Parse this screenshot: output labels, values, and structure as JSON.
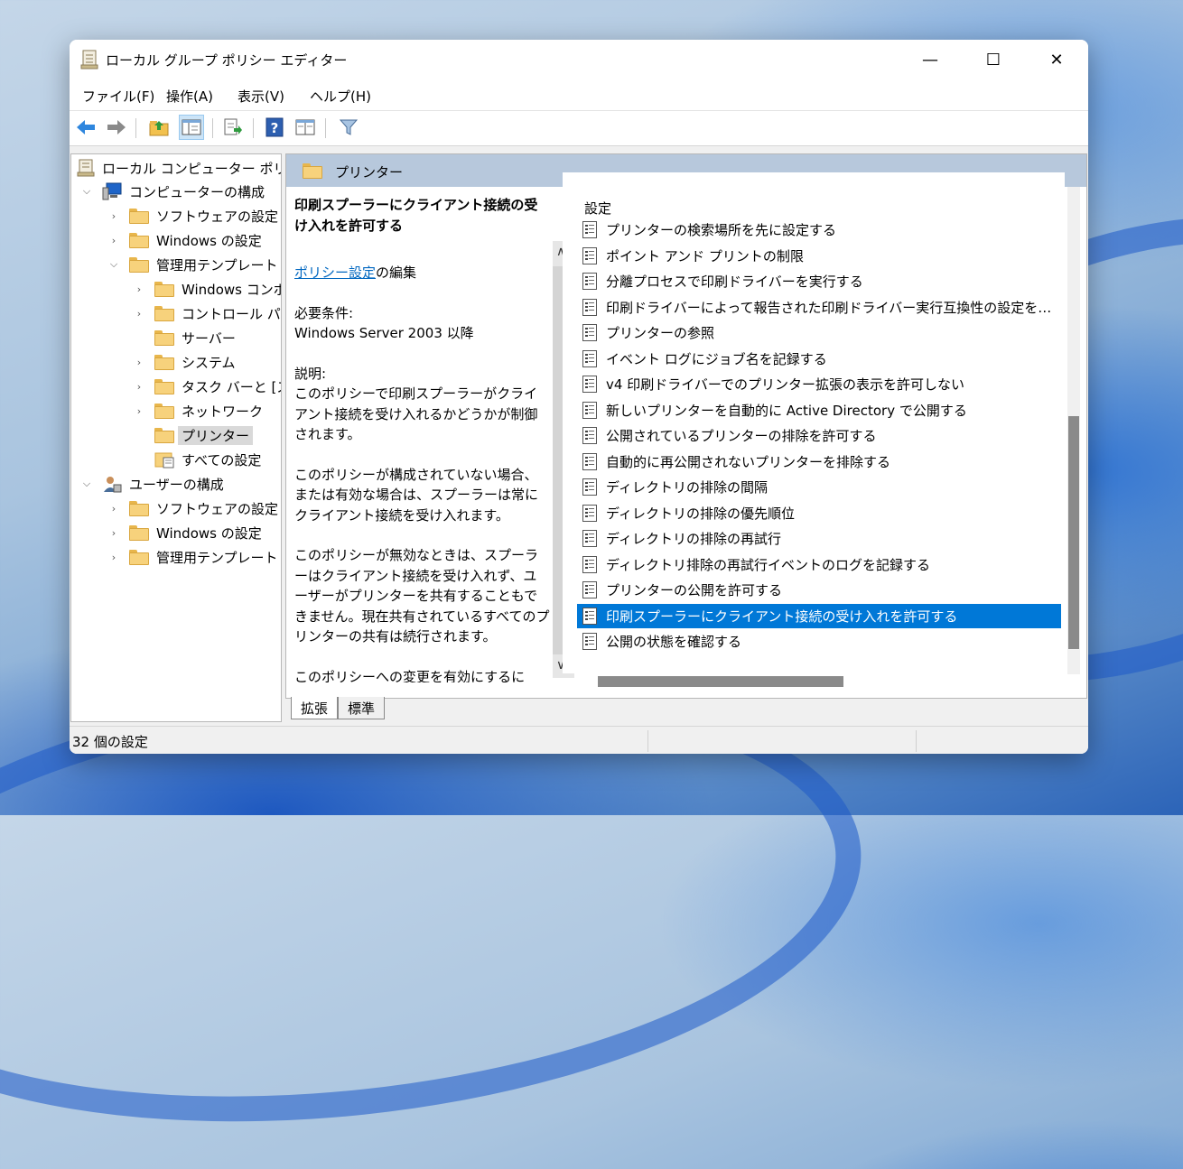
{
  "window": {
    "title": "ローカル グループ ポリシー エディター",
    "minimize": "—",
    "maximize": "☐",
    "close": "✕"
  },
  "menu": [
    "ファイル(F)",
    "操作(A)",
    "表示(V)",
    "ヘルプ(H)"
  ],
  "toolbar_icons": [
    "back-arrow-icon",
    "forward-arrow-icon",
    "up-folder-icon",
    "show-hide-tree-icon",
    "export-list-icon",
    "help-icon",
    "properties-icon",
    "filter-icon"
  ],
  "tree": {
    "root": "ローカル コンピューター ポリシー",
    "computer": "コンピューターの構成",
    "software": "ソフトウェアの設定",
    "windows": "Windows の設定",
    "admin": "管理用テンプレート",
    "win_components": "Windows コンポーネント",
    "control_panel": "コントロール パネル",
    "server": "サーバー",
    "system": "システム",
    "taskbar": "タスク バーと [スタート] メニュー",
    "network": "ネットワーク",
    "printers": "プリンター",
    "all_settings": "すべての設定",
    "user": "ユーザーの構成",
    "u_software": "ソフトウェアの設定",
    "u_windows": "Windows の設定",
    "u_admin": "管理用テンプレート"
  },
  "pane_title": "プリンター",
  "description": {
    "heading": "印刷スプーラーにクライアント接続の受け入れを許可する",
    "link": "ポリシー設定",
    "link_suffix": "の編集",
    "req_label": "必要条件:",
    "req_value": "Windows Server 2003 以降",
    "desc_label": "説明:",
    "p1": "このポリシーで印刷スプーラーがクライアント接続を受け入れるかどうかが制御されます。",
    "p2": "このポリシーが構成されていない場合、または有効な場合は、スプーラーは常にクライアント接続を受け入れます。",
    "p3": "このポリシーが無効なときは、スプーラーはクライアント接続を受け入れず、ユーザーがプリンターを共有することもできません。現在共有されているすべてのプリンターの共有は続行されます。",
    "p4": "このポリシーへの変更を有効にするには、スプーラーを再起動する必要があります。"
  },
  "list_header": "設定",
  "settings": [
    "プリンターの検索場所を先に設定する",
    "ポイント アンド プリントの制限",
    "分離プロセスで印刷ドライバーを実行する",
    "印刷ドライバーによって報告された印刷ドライバー実行互換性の設定を…",
    "プリンターの参照",
    "イベント ログにジョブ名を記録する",
    "v4 印刷ドライバーでのプリンター拡張の表示を許可しない",
    "新しいプリンターを自動的に Active Directory で公開する",
    "公開されているプリンターの排除を許可する",
    "自動的に再公開されないプリンターを排除する",
    "ディレクトリの排除の間隔",
    "ディレクトリの排除の優先順位",
    "ディレクトリの排除の再試行",
    "ディレクトリ排除の再試行イベントのログを記録する",
    "プリンターの公開を許可する",
    "印刷スプーラーにクライアント接続の受け入れを許可する",
    "公開の状態を確認する"
  ],
  "selected_index": 15,
  "tabs": [
    "拡張",
    "標準"
  ],
  "status": "32 個の設定",
  "colors": {
    "selection": "#0078d7",
    "pane_header": "#b7c8dc",
    "link": "#0067c0"
  }
}
